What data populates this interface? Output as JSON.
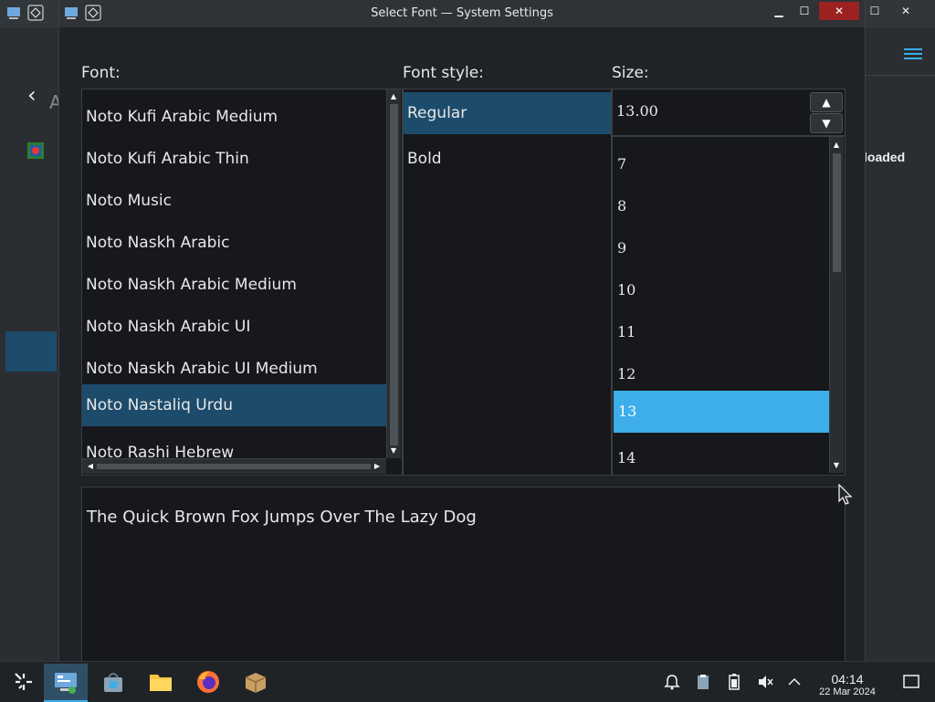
{
  "background_window": {
    "a_letter": "A",
    "right_text": "loaded"
  },
  "dialog": {
    "title": "Select Font — System Settings",
    "font_label": "Font:",
    "style_label": "Font style:",
    "size_label": "Size:",
    "fonts": [
      "Noto Kufi Arabic Medium",
      "Noto Kufi Arabic Thin",
      "Noto Music",
      "Noto Naskh Arabic",
      "Noto Naskh Arabic Medium",
      "Noto Naskh Arabic UI",
      "Noto Naskh Arabic UI Medium",
      "Noto Nastaliq Urdu",
      "Noto Rashi Hebrew"
    ],
    "selected_font": "Noto Nastaliq Urdu",
    "styles": [
      "Regular",
      "Bold"
    ],
    "selected_style": "Regular",
    "size_value": "13.00",
    "sizes": [
      "7",
      "8",
      "9",
      "10",
      "11",
      "12",
      "13",
      "14"
    ],
    "selected_size": "13",
    "preview_text": "The Quick Brown Fox Jumps Over The Lazy Dog"
  },
  "taskbar": {
    "time": "04:14",
    "date": "22 Mar 2024",
    "tasks": [
      "app-launcher",
      "system-settings",
      "discover",
      "dolphin-files",
      "firefox",
      "ark-archiver"
    ],
    "tray": [
      "notifications-icon",
      "clipboard-icon",
      "battery-icon",
      "volume-muted-icon",
      "expand-tray-icon",
      "show-desktop-icon"
    ]
  },
  "colors": {
    "accent": "#3daee9",
    "selection": "#1d4b6b",
    "close_button": "#9c2121"
  }
}
